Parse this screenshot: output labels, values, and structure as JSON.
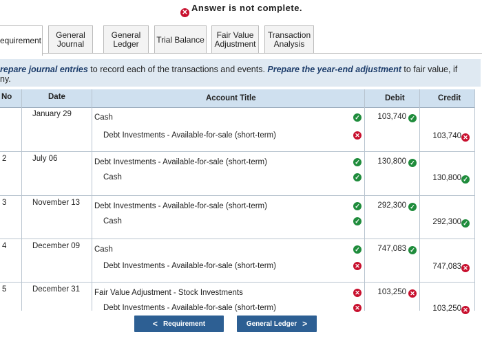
{
  "banner": {
    "text": "Answer is not complete."
  },
  "tabs": [
    {
      "label": "equirement"
    },
    {
      "label": "General Journal"
    },
    {
      "label": "General Ledger"
    },
    {
      "label": "Trial Balance"
    },
    {
      "label": "Fair Value Adjustment"
    },
    {
      "label": "Transaction Analysis"
    }
  ],
  "instructions": {
    "line1_part1": "repare journal entries",
    "line1_part2": " to record each of the transactions and events. ",
    "line1_part3": "Prepare the year-end adjustment",
    "line1_part4": " to fair value, if",
    "line2": "ny."
  },
  "table": {
    "headers": {
      "no": "No",
      "date": "Date",
      "title": "Account Title",
      "debit": "Debit",
      "credit": "Credit"
    },
    "rows": [
      {
        "no": "",
        "date": "January 29",
        "title": "Cash",
        "title_status": "ok",
        "debit": "103,740",
        "debit_status": "ok",
        "credit": "",
        "credit_status": ""
      },
      {
        "no": "",
        "date": "",
        "title": "Debt Investments - Available-for-sale (short-term)",
        "title_status": "bad",
        "debit": "",
        "debit_status": "",
        "credit": "103,740",
        "credit_status": "bad"
      },
      {
        "no": "2",
        "date": "July 06",
        "title": "Debt Investments - Available-for-sale (short-term)",
        "title_status": "ok",
        "debit": "130,800",
        "debit_status": "ok",
        "credit": "",
        "credit_status": ""
      },
      {
        "no": "",
        "date": "",
        "title": "Cash",
        "title_status": "ok",
        "debit": "",
        "debit_status": "",
        "credit": "130,800",
        "credit_status": "ok"
      },
      {
        "no": "3",
        "date": "November 13",
        "title": "Debt Investments - Available-for-sale (short-term)",
        "title_status": "ok",
        "debit": "292,300",
        "debit_status": "ok",
        "credit": "",
        "credit_status": ""
      },
      {
        "no": "",
        "date": "",
        "title": "Cash",
        "title_status": "ok",
        "debit": "",
        "debit_status": "",
        "credit": "292,300",
        "credit_status": "ok"
      },
      {
        "no": "4",
        "date": "December 09",
        "title": "Cash",
        "title_status": "ok",
        "debit": "747,083",
        "debit_status": "ok",
        "credit": "",
        "credit_status": ""
      },
      {
        "no": "",
        "date": "",
        "title": "Debt Investments - Available-for-sale (short-term)",
        "title_status": "bad",
        "debit": "",
        "debit_status": "",
        "credit": "747,083",
        "credit_status": "bad"
      },
      {
        "no": "5",
        "date": "December 31",
        "title": "Fair Value Adjustment - Stock Investments",
        "title_status": "bad",
        "debit": "103,250",
        "debit_status": "bad",
        "credit": "",
        "credit_status": ""
      },
      {
        "no": "",
        "date": "",
        "title": "Debt Investments - Available-for-sale (short-term)",
        "title_status": "bad",
        "debit": "",
        "debit_status": "",
        "credit": "103,250",
        "credit_status": "bad"
      }
    ]
  },
  "nav": {
    "prev_label": "Requirement",
    "next_label": "General Ledger"
  },
  "icons": {
    "ok": "check-circle-icon",
    "bad": "x-circle-icon"
  },
  "colors": {
    "ok": "#1f8c3c",
    "bad": "#c8102e",
    "header": "#cfe0ef",
    "button": "#2d5f93"
  }
}
